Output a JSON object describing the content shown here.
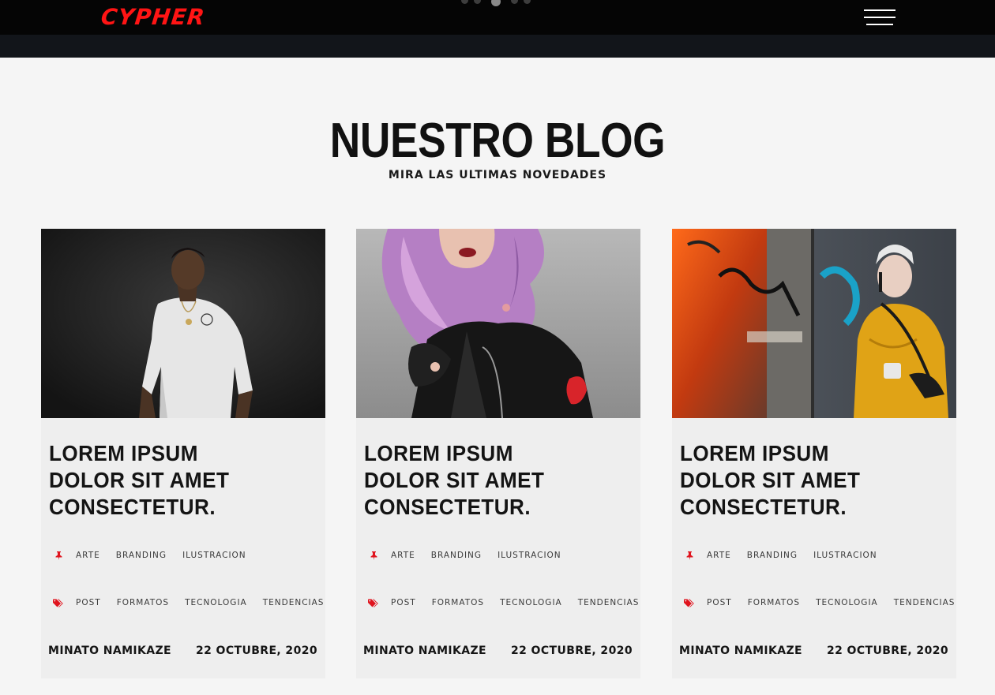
{
  "brand": {
    "logo_text": "CYPHER",
    "accent": "#ff1414"
  },
  "header": {
    "menu_icon": "hamburger-icon",
    "slider_dots": 5,
    "active_dot": 3
  },
  "section": {
    "title": "NUESTRO BLOG",
    "subtitle": "MIRA LAS ULTIMAS NOVEDADES"
  },
  "posts": [
    {
      "image": "man-white-tshirt-photo",
      "title_lines": [
        "LOREM IPSUM",
        "DOLOR SIT AMET",
        "CONSECTETUR."
      ],
      "categories": [
        "ARTE",
        "BRANDING",
        "ILUSTRACION"
      ],
      "tags": [
        "POST",
        "FORMATOS",
        "TECNOLOGIA",
        "TENDENCIAS"
      ],
      "author": "MINATO NAMIKAZE",
      "date": "22 OCTUBRE, 2020"
    },
    {
      "image": "woman-purple-hair-photo",
      "title_lines": [
        "LOREM IPSUM",
        "DOLOR SIT AMET",
        "CONSECTETUR."
      ],
      "categories": [
        "ARTE",
        "BRANDING",
        "ILUSTRACION"
      ],
      "tags": [
        "POST",
        "FORMATOS",
        "TECNOLOGIA",
        "TENDENCIAS"
      ],
      "author": "MINATO NAMIKAZE",
      "date": "22 OCTUBRE, 2020"
    },
    {
      "image": "graffiti-wall-yellow-jacket-photo",
      "title_lines": [
        "LOREM IPSUM",
        "DOLOR SIT AMET",
        "CONSECTETUR."
      ],
      "categories": [
        "ARTE",
        "BRANDING",
        "ILUSTRACION"
      ],
      "tags": [
        "POST",
        "FORMATOS",
        "TECNOLOGIA",
        "TENDENCIAS"
      ],
      "author": "MINATO NAMIKAZE",
      "date": "22 OCTUBRE, 2020"
    }
  ],
  "icons": {
    "category": "pin-icon",
    "tag": "tags-icon"
  }
}
